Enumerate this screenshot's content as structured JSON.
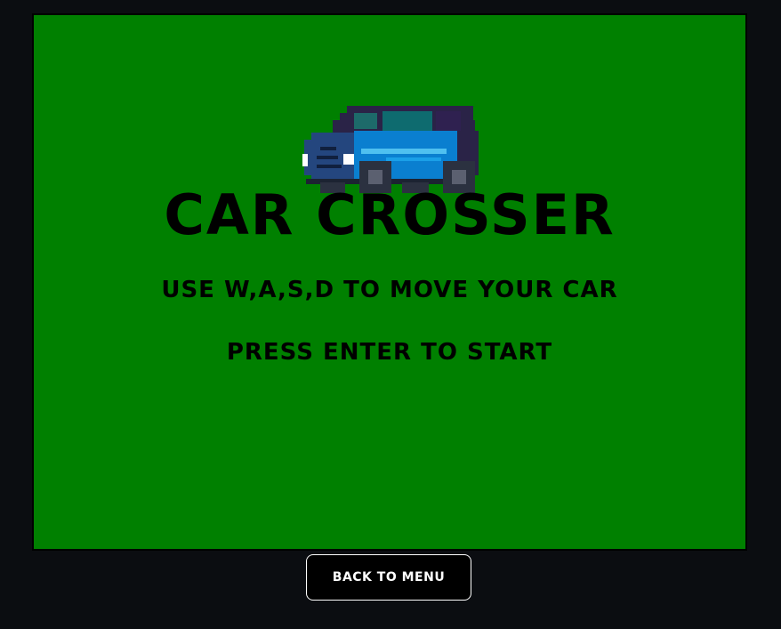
{
  "game": {
    "title": "CAR CROSSER",
    "controls_text": "USE W,A,S,D TO MOVE YOUR CAR",
    "start_text": "PRESS ENTER TO START",
    "background_color": "#008000",
    "sprite": "pixel-art-blue-van"
  },
  "page": {
    "back_button_label": "BACK TO MENU",
    "background_color": "#0b0d11"
  },
  "colors": {
    "van_body": "#0a7fd0",
    "van_front": "#24467e",
    "van_roof": "#2a2347",
    "van_window": "#0e6b6f",
    "headlight": "#ffffff"
  }
}
